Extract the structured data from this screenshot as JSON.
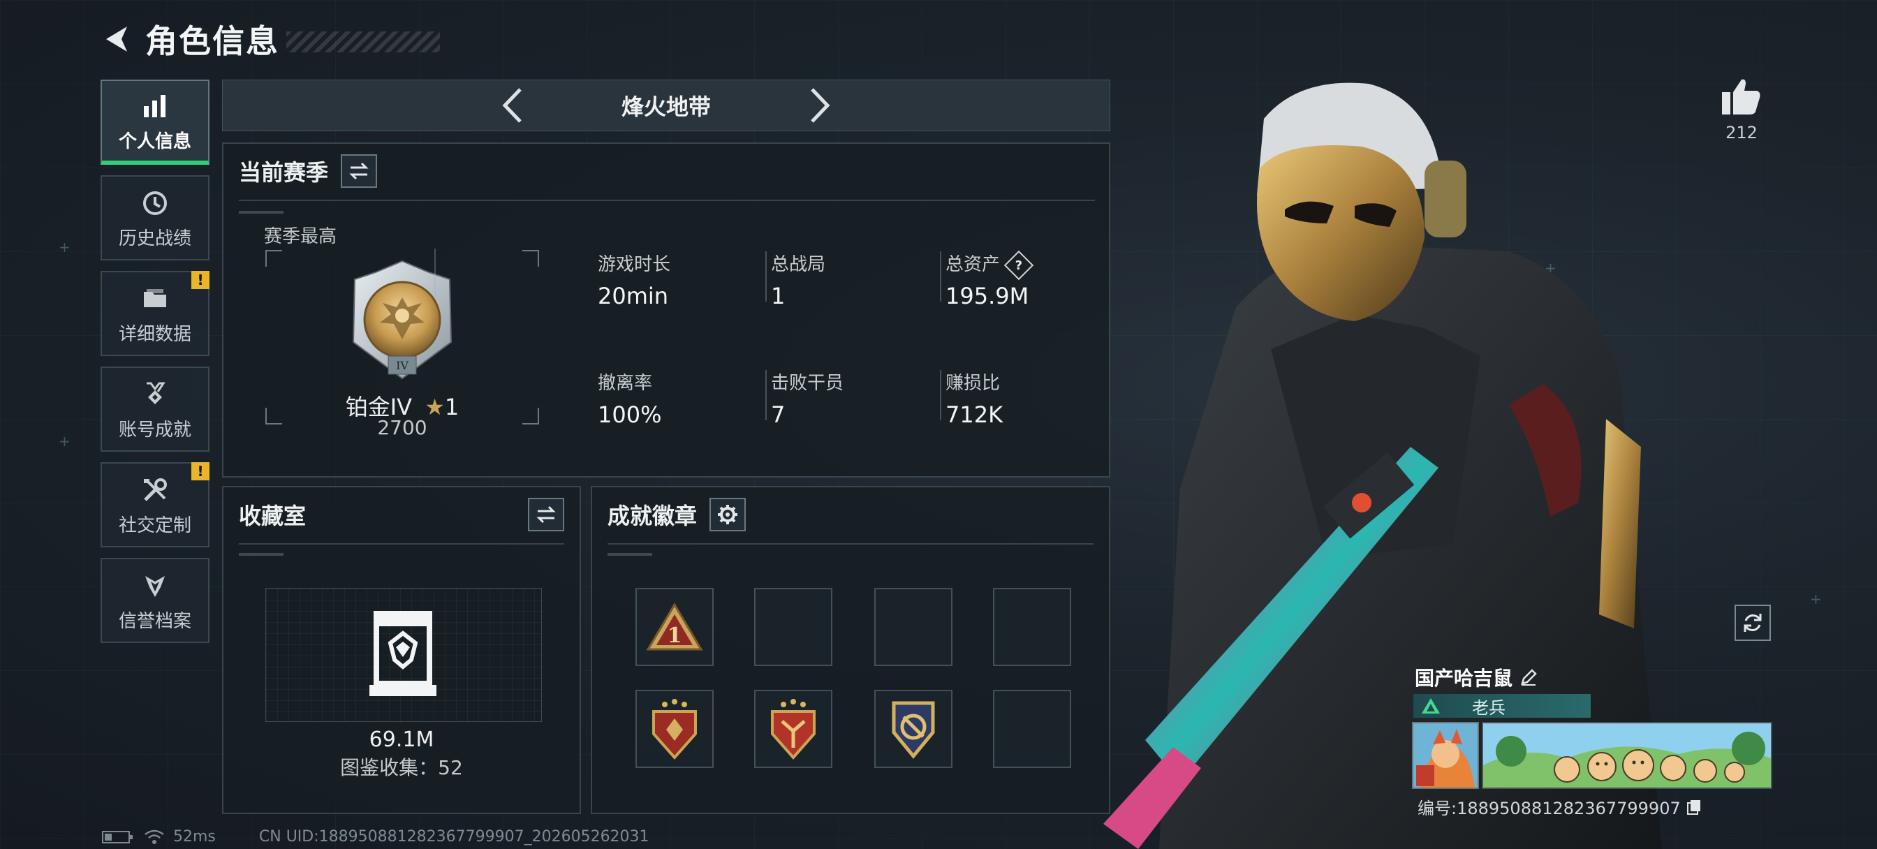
{
  "header": {
    "title": "角色信息"
  },
  "sidebar": {
    "items": [
      {
        "label": "个人信息",
        "active": true,
        "icon": "bar-chart-icon",
        "warn": false
      },
      {
        "label": "历史战绩",
        "active": false,
        "icon": "history-icon",
        "warn": false
      },
      {
        "label": "详细数据",
        "active": false,
        "icon": "folder-icon",
        "warn": true
      },
      {
        "label": "账号成就",
        "active": false,
        "icon": "achievement-icon",
        "warn": false
      },
      {
        "label": "社交定制",
        "active": false,
        "icon": "tools-icon",
        "warn": true
      },
      {
        "label": "信誉档案",
        "active": false,
        "icon": "reputation-icon",
        "warn": false
      }
    ],
    "warn_mark": "!"
  },
  "mode": {
    "name": "烽火地带"
  },
  "season": {
    "title": "当前赛季",
    "subtitle": "赛季最高",
    "rank_name": "铂金IV",
    "rank_stars": "1",
    "rank_score": "2700",
    "medal_numeral": "IV",
    "stats": [
      {
        "label": "游戏时长",
        "value": "20min"
      },
      {
        "label": "总战局",
        "value": "1"
      },
      {
        "label": "总资产",
        "value": "195.9M",
        "help": "?"
      },
      {
        "label": "撤离率",
        "value": "100%"
      },
      {
        "label": "击败干员",
        "value": "7"
      },
      {
        "label": "赚损比",
        "value": "712K"
      }
    ]
  },
  "collection": {
    "title": "收藏室",
    "value": "69.1M",
    "count_text": "图鉴收集：52"
  },
  "badges": {
    "title": "成就徽章",
    "first_badge_number": "1"
  },
  "player": {
    "likes": "212",
    "name": "国产哈吉鼠",
    "tag": "老兵",
    "id_text": "编号:18895088128236779990​7"
  },
  "status": {
    "ping": "52ms",
    "uid": "CN UID:1889508812823677999​07_202605262031"
  },
  "colors": {
    "accent_green": "#2fd07a",
    "warn_yellow": "#e8b628",
    "gold": "#c9a45a"
  }
}
